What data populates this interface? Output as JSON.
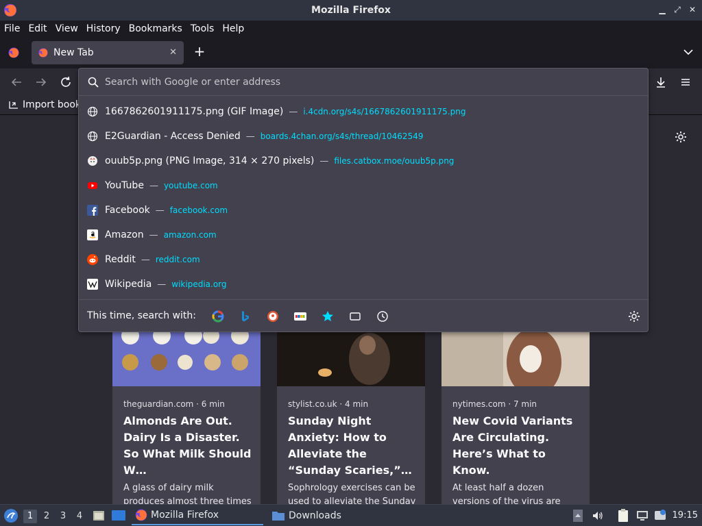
{
  "window": {
    "title": "Mozilla Firefox"
  },
  "menu": [
    "File",
    "Edit",
    "View",
    "History",
    "Bookmarks",
    "Tools",
    "Help"
  ],
  "tab": {
    "title": "New Tab"
  },
  "bookmarks": {
    "import_label": "Import book"
  },
  "urlbar": {
    "placeholder": "Search with Google or enter address",
    "results": [
      {
        "title": "1667862601911175.png (GIF Image)",
        "url": "i.4cdn.org/s4s/1667862601911175.png",
        "icon": "globe-icon"
      },
      {
        "title": "E2Guardian - Access Denied",
        "url": "boards.4chan.org/s4s/thread/10462549",
        "icon": "globe-icon"
      },
      {
        "title": "ouub5p.png (PNG Image, 314 × 270 pixels)",
        "url": "files.catbox.moe/ouub5p.png",
        "icon": "catbox-icon"
      },
      {
        "title": "YouTube",
        "url": "youtube.com",
        "icon": "youtube-icon"
      },
      {
        "title": "Facebook",
        "url": "facebook.com",
        "icon": "facebook-icon"
      },
      {
        "title": "Amazon",
        "url": "amazon.com",
        "icon": "amazon-icon"
      },
      {
        "title": "Reddit",
        "url": "reddit.com",
        "icon": "reddit-icon"
      },
      {
        "title": "Wikipedia",
        "url": "wikipedia.org",
        "icon": "wikipedia-icon"
      }
    ],
    "separator": "—",
    "oneoff_label": "This time, search with:"
  },
  "cards": [
    {
      "source": "theguardian.com · 6 min",
      "headline": "Almonds Are Out. Dairy Is a Disaster. So What Milk Should W…",
      "excerpt": "A glass of dairy milk produces almost three times more greenhouse gas than…"
    },
    {
      "source": "stylist.co.uk · 4 min",
      "headline": "Sunday Night Anxiety: How to Alleviate the “Sunday Scaries,”…",
      "excerpt": "Sophrology exercises can be used to alleviate the Sunday Scaries."
    },
    {
      "source": "nytimes.com · 7 min",
      "headline": "New Covid Variants Are Circulating. Here’s What to Know.",
      "excerpt": "At least half a dozen versions of the virus are competing to become the…"
    }
  ],
  "taskbar": {
    "workspaces": [
      "1",
      "2",
      "3",
      "4"
    ],
    "tasks": [
      {
        "label": "Mozilla Firefox"
      },
      {
        "label": "Downloads"
      }
    ],
    "clock": "19:15"
  },
  "colors": {
    "accent_url": "#00ddff",
    "popup_bg": "#42414d",
    "chrome_bg": "#1c1b22",
    "taskbar_bg": "#2f3440"
  }
}
